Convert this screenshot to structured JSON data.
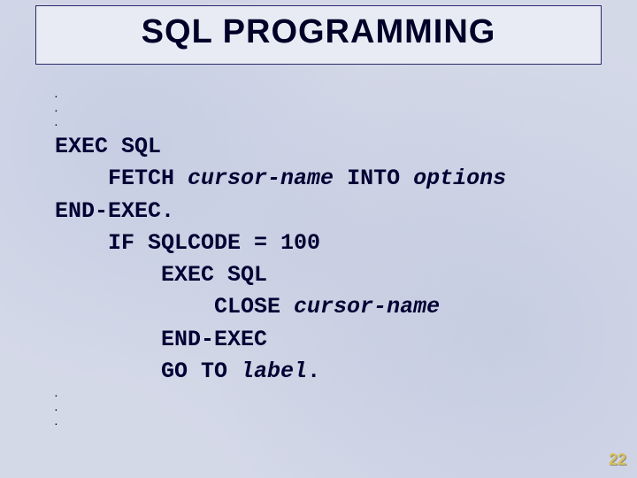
{
  "title": "SQL PROGRAMMING",
  "code": {
    "dots_top": ".\n.\n.",
    "l1": "EXEC SQL",
    "l2a": "    FETCH ",
    "l2b": "cursor-name",
    "l2c": " INTO ",
    "l2d": "options",
    "l3": "END-EXEC.",
    "l4": "    IF SQLCODE = 100",
    "l5": "        EXEC SQL",
    "l6a": "            CLOSE ",
    "l6b": "cursor-name",
    "l7": "        END-EXEC",
    "l8a": "        GO TO ",
    "l8b": "label",
    "l8c": ".",
    "dots_bottom": ".\n.\n."
  },
  "page_number": "22"
}
